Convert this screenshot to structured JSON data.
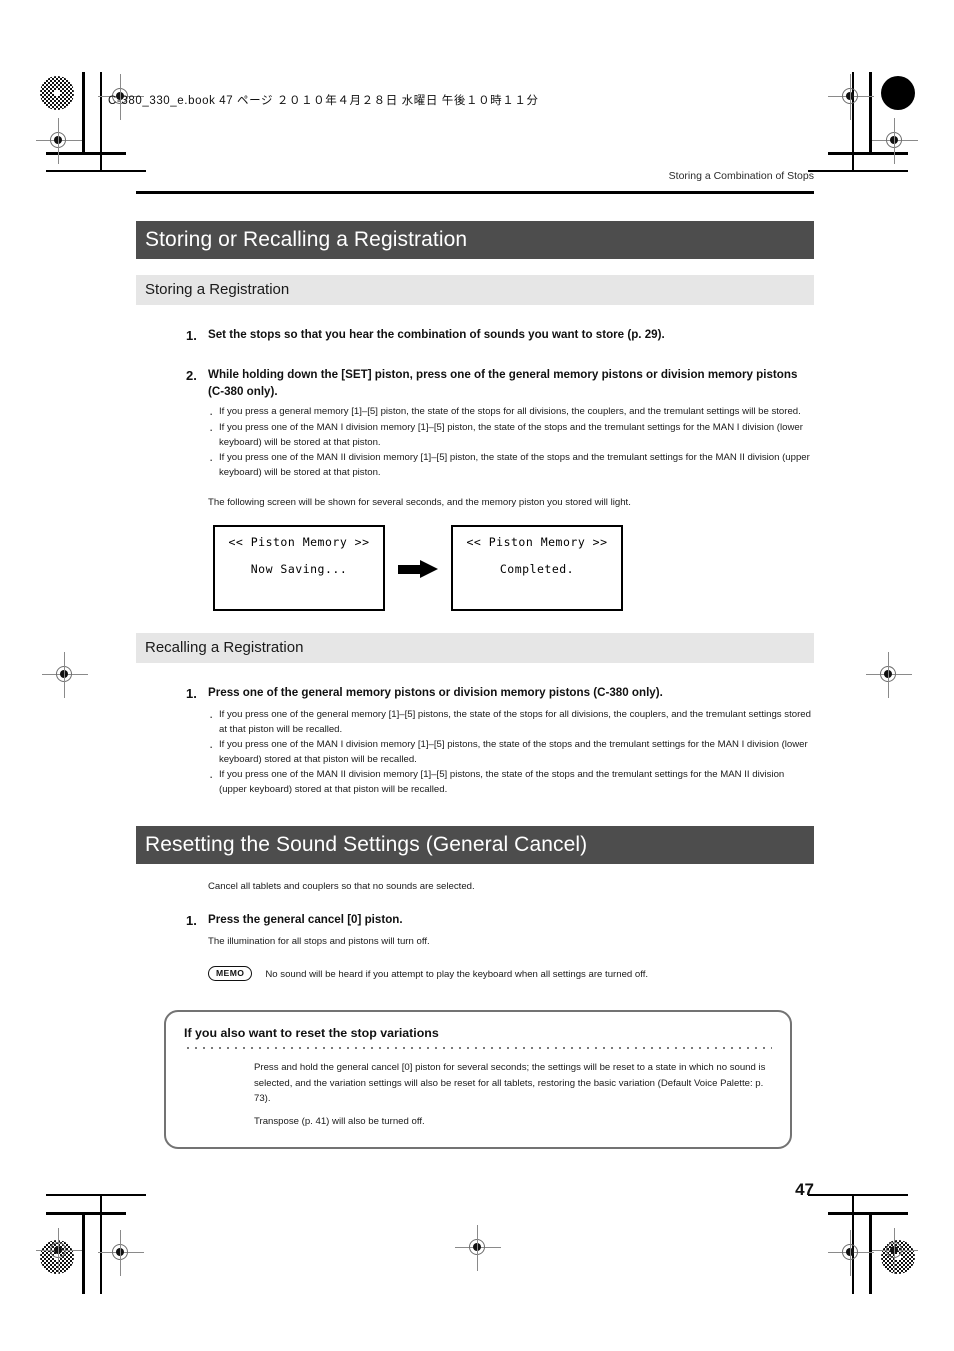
{
  "print": {
    "book_slug": "C-380_330_e.book  47 ページ  ２０１０年４月２８日   水曜日   午後１０時１１分"
  },
  "header": {
    "running_head": "Storing a Combination of Stops"
  },
  "sections": [
    {
      "id": "storing-or-recalling",
      "title": "Storing or Recalling a Registration",
      "subsections": [
        {
          "id": "storing-a-registration",
          "title": "Storing a Registration",
          "steps": [
            {
              "num": "1.",
              "text": "Set the stops so that you hear the combination of sounds you want to store (p. 29)."
            },
            {
              "num": "2.",
              "text": "While holding down the [SET] piston, press one of the general memory pistons or division memory pistons (C-380 only).",
              "bullets": [
                "If you press a general memory [1]–[5] piston, the state of the stops for all divisions, the couplers, and the tremulant settings will be stored.",
                "If you press one of the MAN I division memory [1]–[5] piston, the state of the stops and the tremulant settings for the MAN I division (lower keyboard) will be stored at that piston.",
                "If you press one of the MAN II division memory [1]–[5] piston, the state of the stops and the tremulant settings for the MAN II division (upper keyboard) will be stored at that piston."
              ],
              "note": "The following screen will be shown for several seconds, and the memory piston you stored will light."
            }
          ],
          "lcd_screens": [
            {
              "line1": "<< Piston Memory >>",
              "line2": "Now Saving..."
            },
            {
              "line1": "<< Piston Memory >>",
              "line2": "Completed."
            }
          ]
        },
        {
          "id": "recalling-a-registration",
          "title": "Recalling a Registration",
          "steps": [
            {
              "num": "1.",
              "text": "Press one of the general memory pistons or division memory pistons (C-380 only).",
              "bullets": [
                "If you press one of the general memory [1]–[5] pistons, the state of the stops for all divisions, the couplers, and the tremulant settings stored at that piston will be recalled.",
                "If you press one of the MAN I division memory [1]–[5] pistons, the state of the stops and the tremulant settings for the MAN I division (lower keyboard) stored at that piston will be recalled.",
                "If you press one of the MAN II division memory [1]–[5] pistons, the state of the stops and the tremulant settings for the MAN II division (upper keyboard) stored at that piston will be recalled."
              ]
            }
          ]
        }
      ]
    },
    {
      "id": "resetting-sound-settings",
      "title": "Resetting the Sound Settings (General Cancel)",
      "intro": "Cancel all tablets and couplers so that no sounds are selected.",
      "steps": [
        {
          "num": "1.",
          "text": "Press the general cancel [0] piston.",
          "note": "The illumination for all stops and pistons will turn off."
        }
      ],
      "memo": {
        "badge": "MEMO",
        "text": "No sound will be heard if you attempt to play the keyboard when all settings are turned off."
      },
      "callout": {
        "title": "If you also want to reset the stop variations",
        "paragraphs": [
          "Press and hold the general cancel [0] piston for several seconds; the settings will be reset to a state in which no sound is selected, and the variation settings will also be reset for all tablets, restoring the basic variation (Default Voice Palette: p. 73).",
          "Transpose (p. 41) will also be turned off."
        ]
      }
    }
  ],
  "footer": {
    "page_number": "47"
  },
  "colors": {
    "section_bar": "#4d4d4d",
    "sub_bar": "#e6e6e6",
    "callout_border": "#737373",
    "rule": "#000000"
  }
}
